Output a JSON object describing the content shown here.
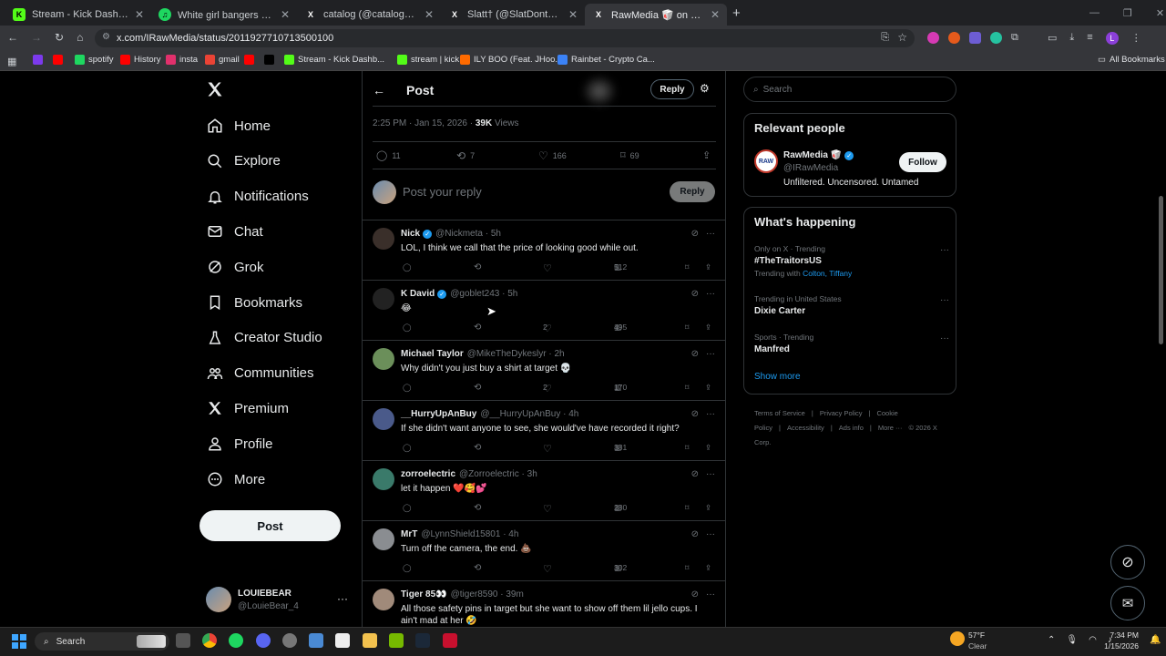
{
  "browser": {
    "tabs": [
      {
        "title": "Stream - Kick Dashboard",
        "fav": "K",
        "favbg": "#53fc18",
        "favfg": "#000"
      },
      {
        "title": "White girl bangers 🎉🥳 🎶 🪄 🎉",
        "fav": "♫",
        "favbg": "#1ed760",
        "favfg": "#000"
      },
      {
        "title": "catalog (@catalogging) / X",
        "fav": "X",
        "favbg": "#000",
        "favfg": "#fff"
      },
      {
        "title": "Slatt† (@SlatDontMiss) / X",
        "fav": "X",
        "favbg": "#000",
        "favfg": "#fff"
      },
      {
        "title": "RawMedia 🥡 on X: \"The unive",
        "fav": "X",
        "favbg": "#000",
        "favfg": "#fff"
      }
    ],
    "new_tab": "+",
    "url": "x.com/IRawMedia/status/2011927710713500100",
    "bookmarks": [
      {
        "label": "",
        "color": "#7c3aed"
      },
      {
        "label": "",
        "color": "#ff0000"
      },
      {
        "label": "spotify",
        "color": "#1ed760"
      },
      {
        "label": "History",
        "color": "#ff0000"
      },
      {
        "label": "insta",
        "color": "#e1306c"
      },
      {
        "label": "gmail",
        "color": "#ea4335"
      },
      {
        "label": "",
        "color": "#ff0000"
      },
      {
        "label": "",
        "color": "#000"
      },
      {
        "label": "Stream - Kick Dashb...",
        "color": "#53fc18"
      },
      {
        "label": "stream | kick",
        "color": "#53fc18"
      },
      {
        "label": "ILY BOO (Feat. JHoo...",
        "color": "#ff6a00"
      },
      {
        "label": "Rainbet - Crypto Ca...",
        "color": "#3b82f6"
      }
    ],
    "all_bookmarks": "All Bookmarks"
  },
  "sidebar": {
    "items": [
      {
        "label": "Home",
        "icon": "home-icon"
      },
      {
        "label": "Explore",
        "icon": "search-icon"
      },
      {
        "label": "Notifications",
        "icon": "bell-icon"
      },
      {
        "label": "Chat",
        "icon": "mail-icon"
      },
      {
        "label": "Grok",
        "icon": "grok-icon"
      },
      {
        "label": "Bookmarks",
        "icon": "bookmark-icon"
      },
      {
        "label": "Creator Studio",
        "icon": "flask-icon"
      },
      {
        "label": "Communities",
        "icon": "communities-icon"
      },
      {
        "label": "Premium",
        "icon": "x-icon"
      },
      {
        "label": "Profile",
        "icon": "person-icon"
      },
      {
        "label": "More",
        "icon": "more-circle-icon"
      }
    ],
    "post_label": "Post",
    "account": {
      "name": "LOUIEBEAR",
      "handle": "@LouieBear_4"
    }
  },
  "header": {
    "title": "Post",
    "reply_label": "Reply"
  },
  "post": {
    "time": "2:25 PM · Jan 15, 2026 · ",
    "views": "39K",
    "views_label": " Views",
    "replies": "11",
    "reposts": "7",
    "likes": "166",
    "bookmarks": "69",
    "reply_placeholder": "Post your reply",
    "reply_button": "Reply"
  },
  "replies": [
    {
      "name": "Nick",
      "verified": true,
      "handle": "@Nickmeta · 5h",
      "text": "LOL, I think we call that the price of looking good while out.",
      "likes": "",
      "views": "512",
      "avatar": "#3a2f2a"
    },
    {
      "name": "K David",
      "verified": true,
      "handle": "@goblet243 · 5h",
      "text": "😂",
      "likes": "2",
      "views": "495",
      "avatar": "#222"
    },
    {
      "name": "Michael Taylor",
      "verified": false,
      "handle": "@MikeTheDykeslyr · 2h",
      "text": "Why didn't you just buy a shirt at target 💀",
      "likes": "2",
      "views": "170",
      "avatar": "#6b8f5a"
    },
    {
      "name": "__HurryUpAnBuy",
      "verified": false,
      "handle": "@__HurryUpAnBuy · 4h",
      "text": "If she didn't want anyone to see, she would've have recorded it right?",
      "likes": "",
      "views": "381",
      "avatar": "#4a5a8a"
    },
    {
      "name": "zorroelectric",
      "verified": false,
      "handle": "@Zorroelectric · 3h",
      "text": "let it happen ❤️🥰💕",
      "likes": "",
      "views": "280",
      "avatar": "#3a7a6a"
    },
    {
      "name": "MrT",
      "verified": false,
      "handle": "@LynnShield15801 · 4h",
      "text": "Turn off the camera, the end. 💩",
      "likes": "",
      "views": "302",
      "avatar": "#8a8d91"
    },
    {
      "name": "Tiger 85👀",
      "verified": false,
      "handle": "@tiger8590 · 39m",
      "text": "All those safety pins in target but she want to show off them lil jello cups. I ain't mad at her 🤣",
      "likes": "",
      "views": "",
      "avatar": "#a08a7a"
    }
  ],
  "right": {
    "search_placeholder": "Search",
    "relevant_title": "Relevant people",
    "person": {
      "name": "RawMedia 🥡",
      "handle": "@IRawMedia",
      "bio": "Unfiltered. Uncensored. Untamed",
      "follow": "Follow"
    },
    "happening_title": "What's happening",
    "trends": [
      {
        "context": "Only on X · Trending",
        "name": "#TheTraitorsUS",
        "with": "Trending with ",
        "with_names": "Colton, Tiffany"
      },
      {
        "context": "Trending in United States",
        "name": "Dixie Carter",
        "with": "",
        "with_names": ""
      },
      {
        "context": "Sports · Trending",
        "name": "Manfred",
        "with": "",
        "with_names": ""
      }
    ],
    "show_more": "Show more",
    "footer": [
      "Terms of Service",
      "|",
      "Privacy Policy",
      "|",
      "Cookie Policy",
      "|",
      "Accessibility",
      "|",
      "Ads info",
      "|",
      "More ···",
      "© 2026 X Corp."
    ]
  },
  "taskbar": {
    "search": "Search",
    "weather_temp": "57°F",
    "weather_desc": "Clear",
    "time": "7:34 PM",
    "date": "1/15/2026"
  },
  "colors": {
    "accent": "#1d9bf0",
    "bg": "#000000",
    "border": "#2f3336",
    "muted": "#71767b"
  }
}
